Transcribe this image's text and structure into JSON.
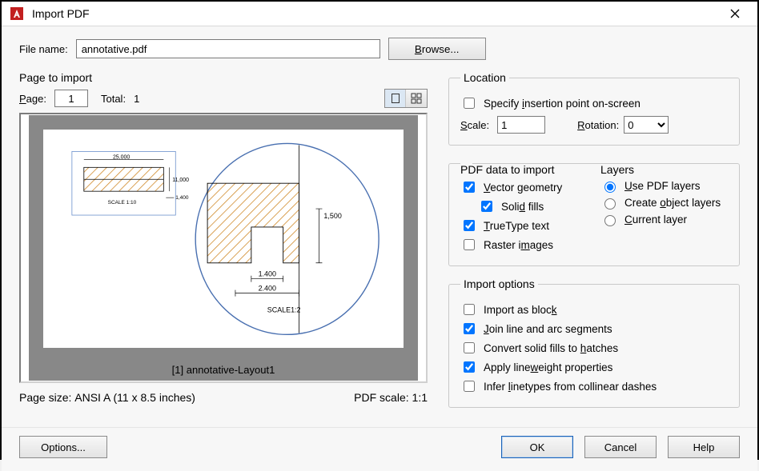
{
  "window": {
    "title": "Import PDF"
  },
  "filename": {
    "label": "File name:",
    "value": "annotative.pdf",
    "browse": "Browse..."
  },
  "page_to_import": {
    "title": "Page to import",
    "page_label": "Page:",
    "page_value": "1",
    "total_label": "Total:",
    "total_value": "1",
    "caption": "[1] annotative-Layout1"
  },
  "preview_labels": {
    "dim_25": "25,000",
    "dim_11": "11,000",
    "scale_110": "SCALE  1:10",
    "dim_1400s": "1,400",
    "dim_1500": "1,500",
    "dim_1400": "1.400",
    "dim_2400": "2.400",
    "scale_12": "SCALE1:2"
  },
  "page_footer": {
    "pagesize_label": "Page size:",
    "pagesize_value": "ANSI A (11 x 8.5 inches)",
    "pdfscale_label": "PDF scale:",
    "pdfscale_value": "1:1"
  },
  "location": {
    "title": "Location",
    "specify": "Specify insertion point on-screen",
    "scale_label": "Scale:",
    "scale_value": "1",
    "rotation_label": "Rotation:",
    "rotation_value": "0"
  },
  "pdf_data": {
    "title": "PDF data to import",
    "vector": "Vector geometry",
    "solid": "Solid fills",
    "truetype": "TrueType text",
    "raster": "Raster images"
  },
  "layers": {
    "title": "Layers",
    "use_pdf": "Use PDF layers",
    "create_obj": "Create object layers",
    "current": "Current layer"
  },
  "import_options": {
    "title": "Import options",
    "as_block": "Import as block",
    "join": "Join line and arc segments",
    "convert": "Convert solid fills to hatches",
    "linewt": "Apply lineweight properties",
    "infer": "Infer linetypes from collinear dashes"
  },
  "buttons": {
    "options": "Options...",
    "ok": "OK",
    "cancel": "Cancel",
    "help": "Help"
  }
}
